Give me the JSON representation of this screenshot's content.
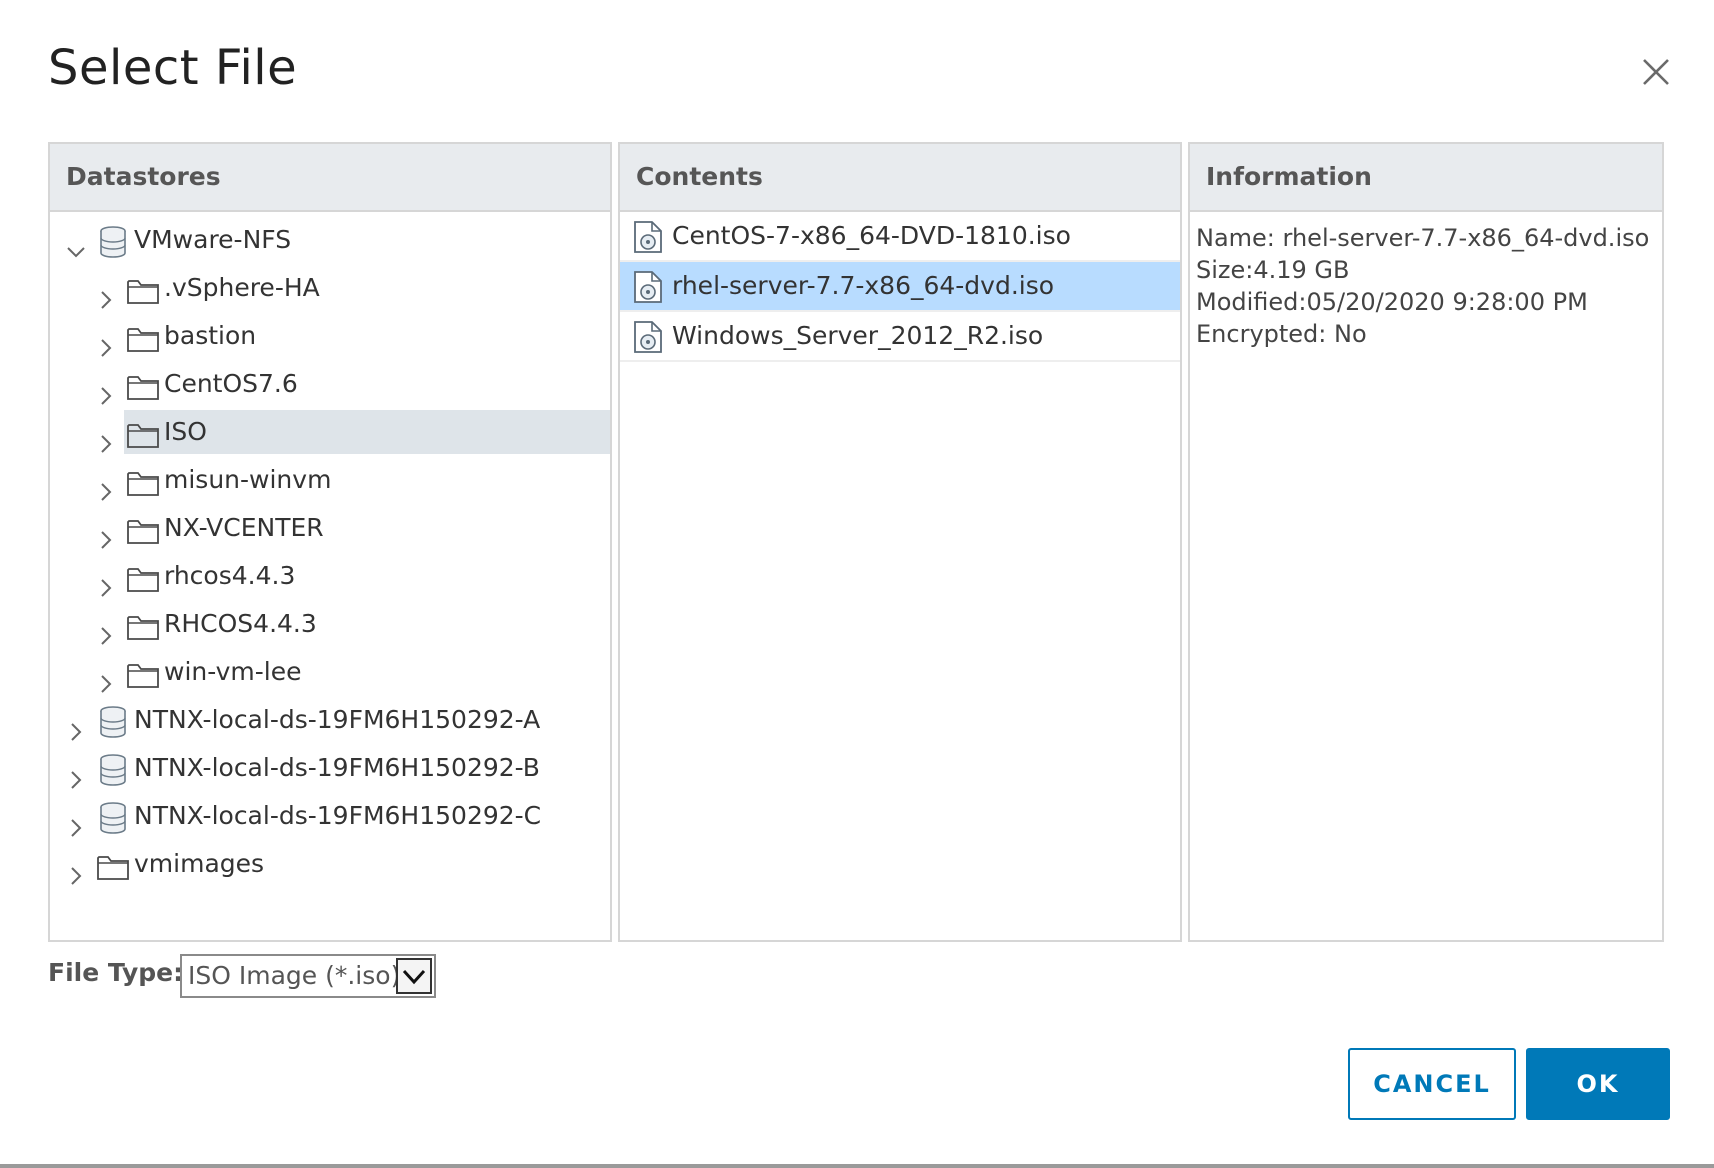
{
  "dialog": {
    "title": "Select File"
  },
  "panels": {
    "datastores_header": "Datastores",
    "contents_header": "Contents",
    "information_header": "Information"
  },
  "datastores": [
    {
      "label": "VMware-NFS",
      "icon": "database-icon",
      "expanded": true,
      "level": 0
    },
    {
      "label": ".vSphere-HA",
      "icon": "folder-icon",
      "level": 1
    },
    {
      "label": "bastion",
      "icon": "folder-icon",
      "level": 1
    },
    {
      "label": "CentOS7.6",
      "icon": "folder-icon",
      "level": 1
    },
    {
      "label": "ISO",
      "icon": "folder-icon",
      "level": 1,
      "selected": true
    },
    {
      "label": "misun-winvm",
      "icon": "folder-icon",
      "level": 1
    },
    {
      "label": "NX-VCENTER",
      "icon": "folder-icon",
      "level": 1
    },
    {
      "label": "rhcos4.4.3",
      "icon": "folder-icon",
      "level": 1
    },
    {
      "label": "RHCOS4.4.3",
      "icon": "folder-icon",
      "level": 1
    },
    {
      "label": "win-vm-lee",
      "icon": "folder-icon",
      "level": 1
    },
    {
      "label": "NTNX-local-ds-19FM6H150292-A",
      "icon": "database-icon",
      "level": 0
    },
    {
      "label": "NTNX-local-ds-19FM6H150292-B",
      "icon": "database-icon",
      "level": 0
    },
    {
      "label": "NTNX-local-ds-19FM6H150292-C",
      "icon": "database-icon",
      "level": 0
    },
    {
      "label": "vmimages",
      "icon": "folder-icon",
      "level": 0
    }
  ],
  "contents": [
    {
      "label": "CentOS-7-x86_64-DVD-1810.iso",
      "icon": "disc-image-icon"
    },
    {
      "label": "rhel-server-7.7-x86_64-dvd.iso",
      "icon": "disc-image-icon",
      "selected": true
    },
    {
      "label": "Windows_Server_2012_R2.iso",
      "icon": "disc-image-icon"
    }
  ],
  "information": {
    "name": "Name: rhel-server-7.7-x86_64-dvd.iso",
    "size": "Size:4.19 GB",
    "modified": "Modified:05/20/2020 9:28:00 PM",
    "encrypted": "Encrypted: No"
  },
  "file_type": {
    "label": "File Type:",
    "value": "ISO Image (*.iso)"
  },
  "buttons": {
    "cancel": "CANCEL",
    "ok": "OK"
  },
  "colors": {
    "accent": "#0079b8",
    "selected_file_bg": "#b8dcff",
    "selected_tree_bg": "#dee4e9",
    "header_bg": "#e8ebee"
  }
}
